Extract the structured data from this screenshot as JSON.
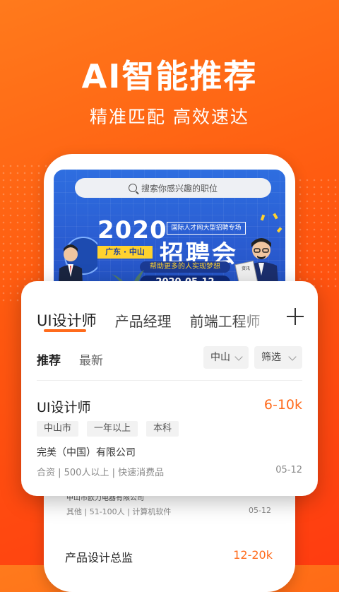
{
  "hero": {
    "headline": "AI智能推荐",
    "subline": "精准匹配  高效速达"
  },
  "banner": {
    "search_placeholder": "搜索你感兴趣的职位",
    "year": "2020",
    "location_ribbon": "广东 · 中山",
    "expo_top": "国际人才网大型招聘专场",
    "expo_title": "招聘会",
    "slogan": "帮助更多的人实现梦想",
    "date": "2020-05-12",
    "newspaper_label": "资讯"
  },
  "tabs": [
    {
      "label": "UI设计师",
      "active": true
    },
    {
      "label": "产品经理",
      "active": false
    },
    {
      "label": "前端工程师",
      "active": false
    }
  ],
  "sort": {
    "recommend": "推荐",
    "latest": "最新"
  },
  "filters": {
    "city": "中山",
    "filter": "筛选"
  },
  "job": {
    "title": "UI设计师",
    "salary": "6-10k",
    "tags": [
      "中山市",
      "一年以上",
      "本科"
    ],
    "company": "完美（中国）有限公司",
    "meta": "合资 | 500人以上 | 快速消费品",
    "date": "05-12"
  },
  "under_card": {
    "company": "中山市欧力电器有限公司",
    "meta": "其他 | 51-100人 | 计算机软件",
    "date": "05-12"
  },
  "next_job": {
    "title": "产品设计总监",
    "salary": "12-20k"
  },
  "colors": {
    "accent": "#ff6b1c",
    "banner_blue": "#2a5bd0",
    "ribbon_yellow": "#ffd22e"
  }
}
